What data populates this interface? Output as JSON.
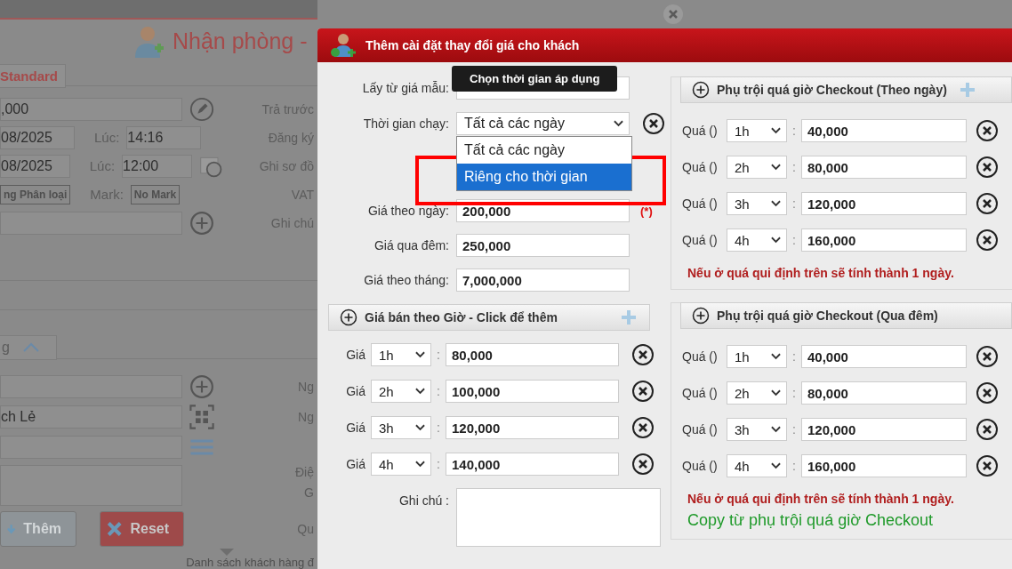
{
  "background_page": {
    "title": "Nhận phòng -",
    "room_tab": "Standard",
    "price_value": ",000",
    "checkin": {
      "date": "08/2025",
      "time_label": "Lúc:",
      "time": "14:16"
    },
    "checkout": {
      "date": "08/2025",
      "time_label": "Lúc:",
      "time": "12:00"
    },
    "category_button": "ng Phân loại",
    "mark_label": "Mark:",
    "mark_button": "No Mark",
    "right_labels": [
      "Trả trước",
      "Đăng ký",
      "Ghi sơ đồ",
      "VAT",
      "Ghi chú"
    ],
    "guest_tab": "g",
    "guest_fields": [
      {
        "kind": "add",
        "side_label": "Ng"
      },
      {
        "kind": "scan",
        "value": "ch Lẻ",
        "side_label": "Ng"
      },
      {
        "kind": "list"
      }
    ],
    "note_side_labels": [
      "Điệ",
      "G"
    ],
    "buttons": [
      {
        "kind": "add",
        "label": "Thêm"
      },
      {
        "kind": "reset",
        "label": "Reset"
      }
    ],
    "buttons_side_label": "Qu",
    "bottom_tab": "Danh sách khách hàng đ"
  },
  "dialog": {
    "title": "Thêm cài đặt thay đổi giá cho khách",
    "template_label": "Lấy từ giá mẫu:",
    "tooltip": "Chọn thời gian áp dụng",
    "schedule_label": "Thời gian chạy:",
    "schedule_value": "Tất cả các ngày",
    "schedule_options": [
      {
        "label": "Tất cả các ngày",
        "selected": false
      },
      {
        "label": "Riêng cho thời gian",
        "selected": true
      }
    ],
    "prices": [
      {
        "label": "Giá theo ngày:",
        "value": "200,000",
        "required": "(*)"
      },
      {
        "label": "Giá qua đêm:",
        "value": "250,000"
      },
      {
        "label": "Giá theo tháng:",
        "value": "7,000,000"
      }
    ],
    "hourly": {
      "title": "Giá bán theo Giờ - Click để thêm",
      "add_button": true,
      "rows": [
        {
          "label": "Giá",
          "hours": "1h",
          "sep": ":",
          "value": "80,000"
        },
        {
          "label": "Giá",
          "hours": "2h",
          "sep": ":",
          "value": "100,000"
        },
        {
          "label": "Giá",
          "hours": "3h",
          "sep": ":",
          "value": "120,000"
        },
        {
          "label": "Giá",
          "hours": "4h",
          "sep": ":",
          "value": "140,000"
        }
      ]
    },
    "note_label": "Ghi chú :",
    "surcharges": [
      {
        "title": "Phụ trội quá giờ Checkout (Theo ngày)",
        "add_button": true,
        "rows": [
          {
            "label": "Quá ()",
            "hours": "1h",
            "sep": ":",
            "value": "40,000"
          },
          {
            "label": "Quá ()",
            "hours": "2h",
            "sep": ":",
            "value": "80,000"
          },
          {
            "label": "Quá ()",
            "hours": "3h",
            "sep": ":",
            "value": "120,000"
          },
          {
            "label": "Quá ()",
            "hours": "4h",
            "sep": ":",
            "value": "160,000"
          }
        ],
        "note": "Nếu ở quá qui định trên sẽ tính thành 1 ngày."
      },
      {
        "title": "Phụ trội quá giờ Checkout (Qua đêm)",
        "add_button": false,
        "rows": [
          {
            "label": "Quá ()",
            "hours": "1h",
            "sep": ":",
            "value": "40,000"
          },
          {
            "label": "Quá ()",
            "hours": "2h",
            "sep": ":",
            "value": "80,000"
          },
          {
            "label": "Quá ()",
            "hours": "3h",
            "sep": ":",
            "value": "120,000"
          },
          {
            "label": "Quá ()",
            "hours": "4h",
            "sep": ":",
            "value": "160,000"
          }
        ],
        "note": "Nếu ở quá qui định trên sẽ tính thành 1 ngày.",
        "link": "Copy từ phụ trội quá giờ Checkout"
      }
    ]
  }
}
